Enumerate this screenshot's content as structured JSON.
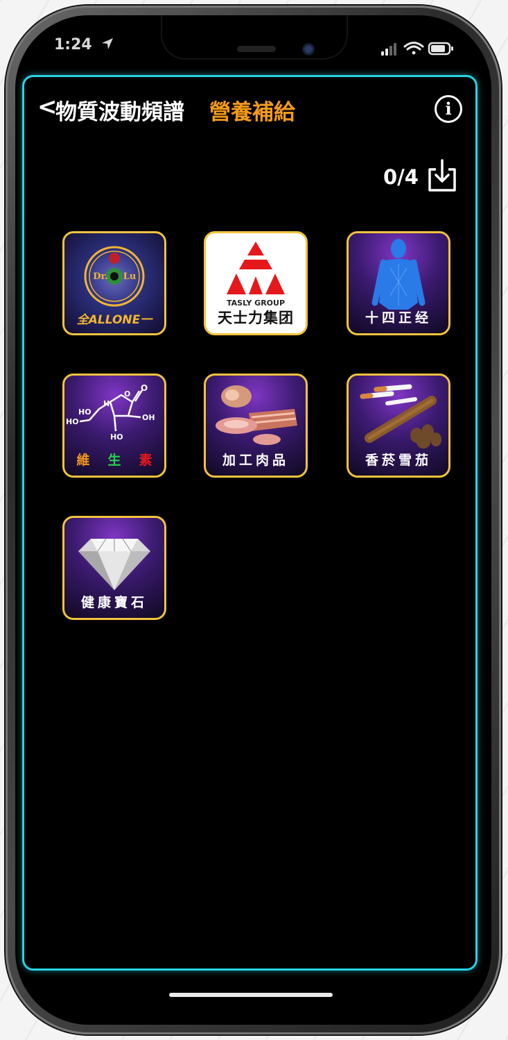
{
  "status": {
    "time": "1:24"
  },
  "header": {
    "back_symbol": "<",
    "title": "物質波動頻譜",
    "subtitle": "營養補給",
    "info_symbol": "i"
  },
  "counter": "0/4",
  "tiles": [
    {
      "label": "",
      "logo_lines": [
        "Dr.",
        "Lu"
      ],
      "logo_caption": "全ALLONE一"
    },
    {
      "label": "天士力集团",
      "logo_top": "TASLY GROUP"
    },
    {
      "label": "十四正经"
    },
    {
      "label_parts": [
        "維",
        "生",
        "素"
      ],
      "label_colors": [
        "#f39a1c",
        "#29d14a",
        "#e5191b"
      ],
      "chem": [
        "HO",
        "H",
        "O",
        "OH",
        "HO",
        "HO"
      ]
    },
    {
      "label": "加工肉品"
    },
    {
      "label": "香菸雪茄"
    },
    {
      "label": "健康寶石"
    }
  ],
  "colors": {
    "frame": "#29d3e6",
    "accent": "#f39a1c",
    "tile_border": "#f2c33d"
  }
}
